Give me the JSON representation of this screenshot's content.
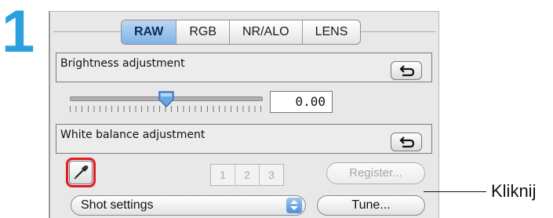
{
  "step": {
    "number": "1",
    "color": "#2aa0dc"
  },
  "tabs": [
    {
      "label": "RAW",
      "active": true
    },
    {
      "label": "RGB",
      "active": false
    },
    {
      "label": "NR/ALO",
      "active": false
    },
    {
      "label": "LENS",
      "active": false
    }
  ],
  "brightness": {
    "label": "Brightness adjustment",
    "reset_icon": "undo-arrow-icon",
    "slider_position": 0.5,
    "value": "0.00"
  },
  "white_balance": {
    "label": "White balance adjustment",
    "reset_icon": "undo-arrow-icon",
    "picker_icon": "eyedropper-icon",
    "picker_highlight_color": "#e21b23",
    "presets": [
      "1",
      "2",
      "3"
    ],
    "register_label": "Register...",
    "select_value": "Shot settings",
    "tune_label": "Tune..."
  },
  "callout": {
    "text": "Kliknij"
  }
}
